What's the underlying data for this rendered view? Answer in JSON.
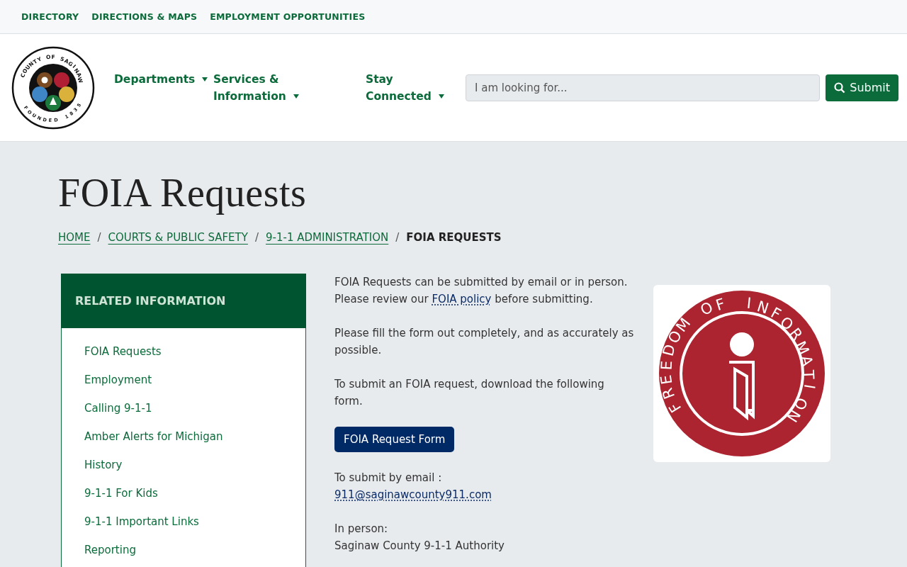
{
  "utility_links": [
    "DIRECTORY",
    "DIRECTIONS & MAPS",
    "EMPLOYMENT OPPORTUNITIES"
  ],
  "logo": {
    "top_text": "COUNTY OF SAGINAW",
    "bottom_text": "FOUNDED 1835"
  },
  "nav": [
    {
      "label": "Departments",
      "has_dropdown": true
    },
    {
      "label": "Services & Information",
      "has_dropdown": true
    },
    {
      "label": "Stay Connected",
      "has_dropdown": true
    }
  ],
  "search": {
    "placeholder": "I am looking for...",
    "button": "Submit"
  },
  "page_title": "FOIA Requests",
  "breadcrumb_separator": "/",
  "breadcrumb": [
    {
      "label": "HOME",
      "current": false
    },
    {
      "label": "COURTS & PUBLIC SAFETY",
      "current": false
    },
    {
      "label": "9-1-1 ADMINISTRATION",
      "current": false
    },
    {
      "label": "FOIA REQUESTS",
      "current": true
    }
  ],
  "sidebar": {
    "title": "RELATED INFORMATION",
    "items": [
      "FOIA Requests",
      "Employment",
      "Calling 9-1-1",
      "Amber Alerts for Michigan",
      "History",
      "9-1-1 For Kids",
      "9-1-1 Important Links",
      "Reporting"
    ]
  },
  "content": [
    {
      "kind": "paragraph",
      "before": "FOIA Requests can be submitted by email or in person.  Please review our ",
      "link": "FOIA policy",
      "after": " before submitting."
    },
    {
      "kind": "paragraph",
      "text": "Please fill the form out completely, and as accurately as possible."
    },
    {
      "kind": "paragraph",
      "text": "To submit an FOIA request, download the following form."
    },
    {
      "kind": "button",
      "text": "FOIA Request Form"
    },
    {
      "kind": "contact",
      "text": "To submit by email :",
      "link": "911@saginawcounty911.com"
    },
    {
      "kind": "contact",
      "text": "In person:",
      "detail": "Saginaw County 9-1-1 Authority"
    }
  ],
  "seal_image": {
    "text": "FREEDOM OF INFORMATION"
  }
}
